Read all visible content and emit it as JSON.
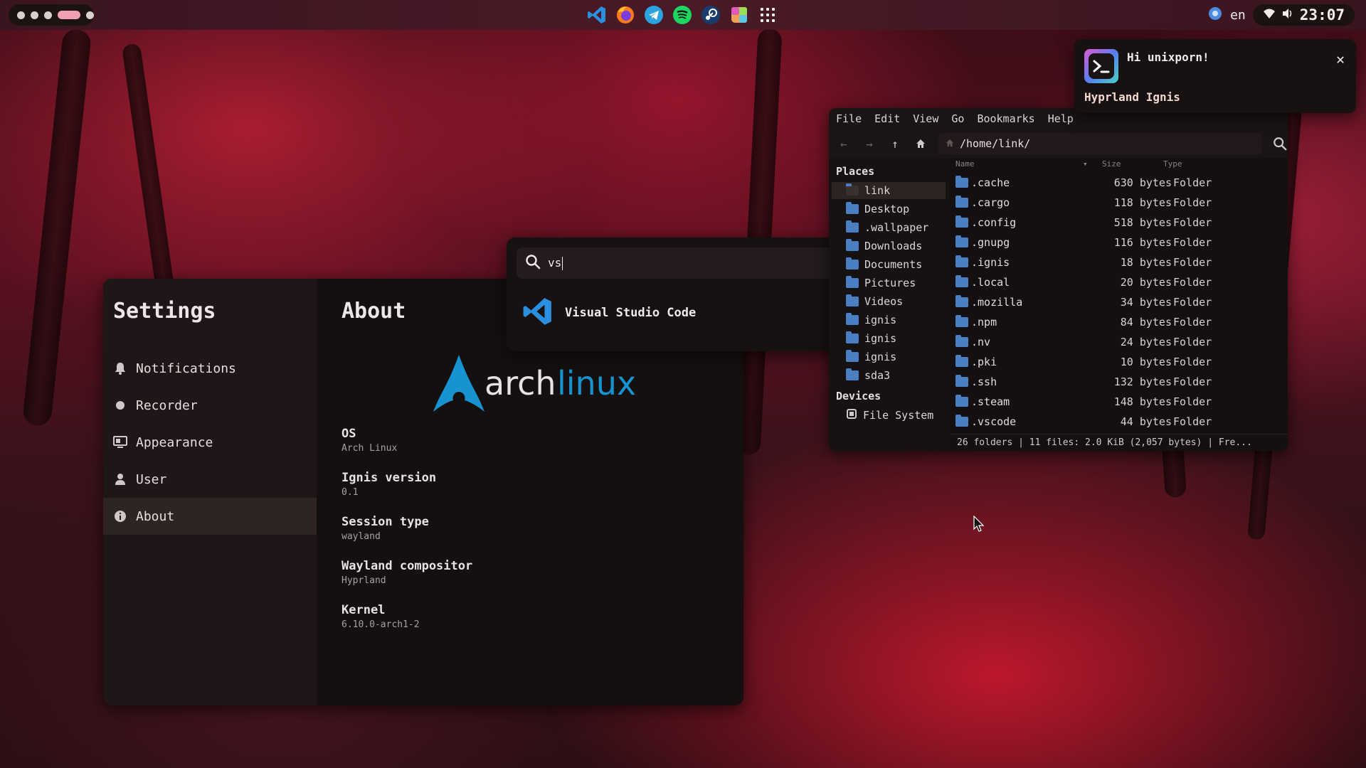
{
  "topbar": {
    "dock_apps": [
      "vscode-icon",
      "firefox-icon",
      "telegram-icon",
      "spotify-icon",
      "steam-icon",
      "photos-icon",
      "app-grid-icon"
    ],
    "language": "en",
    "clock": "23:07"
  },
  "settings": {
    "title": "Settings",
    "sidebar": [
      {
        "label": "Notifications",
        "icon": "bell-icon"
      },
      {
        "label": "Recorder",
        "icon": "record-icon"
      },
      {
        "label": "Appearance",
        "icon": "monitor-icon"
      },
      {
        "label": "User",
        "icon": "user-icon"
      },
      {
        "label": "About",
        "icon": "info-icon",
        "active": true
      }
    ],
    "page_title": "About",
    "logo_text": "archlinux",
    "info": [
      {
        "label": "OS",
        "value": "Arch Linux"
      },
      {
        "label": "Ignis version",
        "value": "0.1"
      },
      {
        "label": "Session type",
        "value": "wayland"
      },
      {
        "label": "Wayland compositor",
        "value": "Hyprland"
      },
      {
        "label": "Kernel",
        "value": "6.10.0-arch1-2"
      }
    ]
  },
  "launcher": {
    "query": "vs",
    "results": [
      {
        "label": "Visual Studio Code",
        "icon": "vscode-icon"
      }
    ]
  },
  "file_manager": {
    "menu": [
      "File",
      "Edit",
      "View",
      "Go",
      "Bookmarks",
      "Help"
    ],
    "path": "/home/link/",
    "places_heading": "Places",
    "places": [
      "link",
      "Desktop",
      ".wallpaper",
      "Downloads",
      "Documents",
      "Pictures",
      "Videos",
      "ignis",
      "ignis",
      "ignis",
      "sda3"
    ],
    "devices_heading": "Devices",
    "devices": [
      "File System"
    ],
    "columns": {
      "name": "Name",
      "size": "Size",
      "type": "Type"
    },
    "rows": [
      {
        "name": ".cache",
        "size": "630 bytes",
        "type": "Folder"
      },
      {
        "name": ".cargo",
        "size": "118 bytes",
        "type": "Folder"
      },
      {
        "name": ".config",
        "size": "518 bytes",
        "type": "Folder"
      },
      {
        "name": ".gnupg",
        "size": "116 bytes",
        "type": "Folder"
      },
      {
        "name": ".ignis",
        "size": "18 bytes",
        "type": "Folder"
      },
      {
        "name": ".local",
        "size": "20 bytes",
        "type": "Folder"
      },
      {
        "name": ".mozilla",
        "size": "34 bytes",
        "type": "Folder"
      },
      {
        "name": ".npm",
        "size": "84 bytes",
        "type": "Folder"
      },
      {
        "name": ".nv",
        "size": "24 bytes",
        "type": "Folder"
      },
      {
        "name": ".pki",
        "size": "10 bytes",
        "type": "Folder"
      },
      {
        "name": ".ssh",
        "size": "132 bytes",
        "type": "Folder"
      },
      {
        "name": ".steam",
        "size": "148 bytes",
        "type": "Folder"
      },
      {
        "name": ".vscode",
        "size": "44 bytes",
        "type": "Folder"
      }
    ],
    "status": "26 folders  |  11 files: 2.0 KiB (2,057 bytes)  |  Fre..."
  },
  "notification": {
    "title": "Hi unixporn!",
    "body": "Hyprland Ignis"
  },
  "colors": {
    "accent": "#f0a0b0",
    "folder": "#4a7fc4",
    "arch_blue": "#1793d1"
  }
}
